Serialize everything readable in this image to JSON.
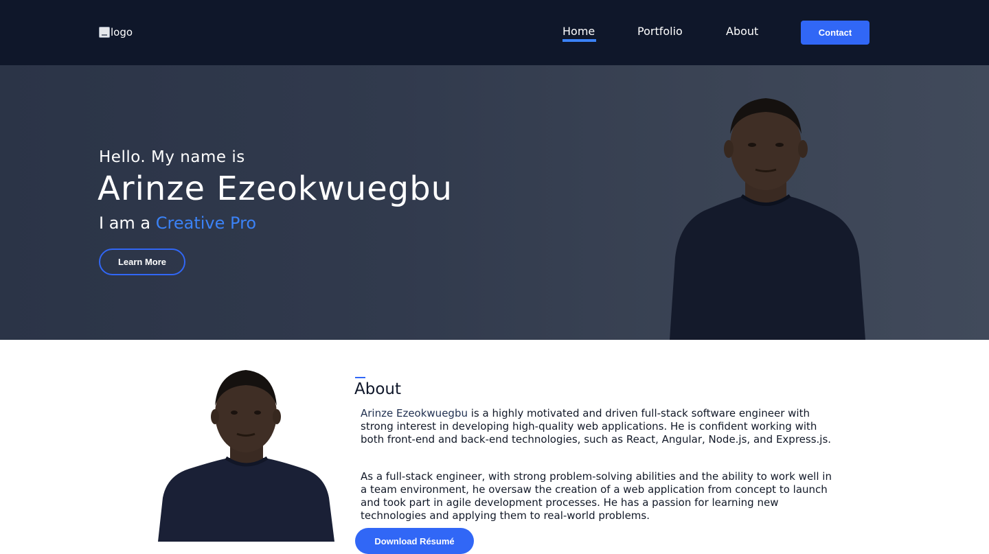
{
  "nav": {
    "logo_alt": "logo",
    "links": [
      "Home",
      "Portfolio",
      "About"
    ],
    "active": "Home",
    "contact_label": "Contact"
  },
  "hero": {
    "greeting": "Hello. My name is",
    "name": "Arinze Ezeokwuegbu",
    "tagline_prefix": "I am a ",
    "tagline_highlight": "Creative Pro",
    "learn_more_label": "Learn More"
  },
  "about": {
    "title": "About",
    "name_highlight": "Arinze Ezeokwuegbu",
    "p1_rest": " is a highly motivated and driven full-stack software engineer with strong interest in developing high-quality web applications. He is confident working with both front-end and back-end technologies, such as React, Angular, Node.js, and Express.js.",
    "p2": "As a full-stack engineer, with strong problem-solving abilities and the ability to work well in a team environment, he oversaw the creation of a web application from concept to launch and took part in agile development processes. He has a passion for learning new technologies and applying them to real-world problems.",
    "download_label": "Download Résumé"
  },
  "colors": {
    "navbar_bg": "#0f172a",
    "accent": "#3167f6",
    "highlight_text": "#3b82f6",
    "hero_bg": "#313a4d"
  }
}
